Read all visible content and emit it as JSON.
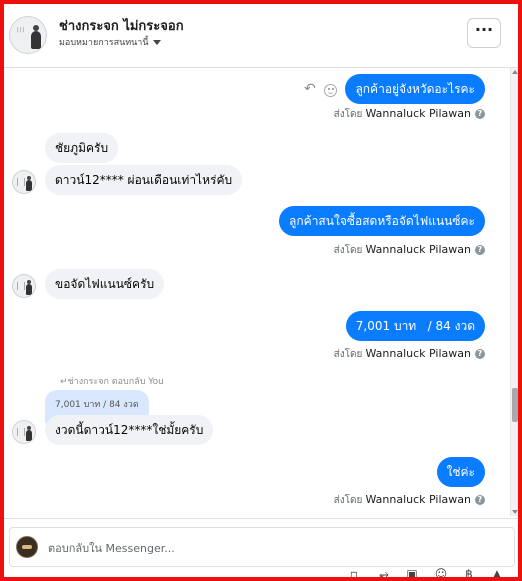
{
  "header": {
    "page_name": "ช่างกระจก ไม่กระจอก",
    "assign_label": "มอบหมายการสนทนานี้",
    "more_label": "···"
  },
  "messages": [
    {
      "from": "page",
      "text": "ลูกค้าอยู่จังหวัดอะไรคะ",
      "sent_by_prefix": "ส่งโดย",
      "sent_by_name": "Wannaluck Pilawan"
    },
    {
      "from": "customer",
      "text": "ชัยภูมิครับ"
    },
    {
      "from": "customer",
      "text": "ดาวน์12**** ผ่อนเดือนเท่าไหร่คับ"
    },
    {
      "from": "page",
      "text": "ลูกค้าสนใจซื้อสดหรือจัดไฟแนนซ์คะ",
      "sent_by_prefix": "ส่งโดย",
      "sent_by_name": "Wannaluck Pilawan"
    },
    {
      "from": "customer",
      "text": "ขอจัดไฟแนนซ์ครับ"
    },
    {
      "from": "page",
      "text": "7,001 บาท   / 84 งวด",
      "sent_by_prefix": "ส่งโดย",
      "sent_by_name": "Wannaluck Pilawan"
    },
    {
      "from": "customer",
      "reply_label": "ช่างกระจก ตอบกลับ You",
      "quoted": "7,001 บาท / 84 งวด",
      "text": "งวดนี้ดาวน์12****ใช่มั้ยครับ"
    },
    {
      "from": "page",
      "text": "ใช่ค่ะ",
      "sent_by_prefix": "ส่งโดย",
      "sent_by_name": "Wannaluck Pilawan"
    }
  ],
  "composer": {
    "placeholder": "ตอบกลับใน Messenger..."
  },
  "colors": {
    "outgoing": "#0a7cff",
    "incoming": "#f0f2f5",
    "frame": "#ee0f0f"
  }
}
